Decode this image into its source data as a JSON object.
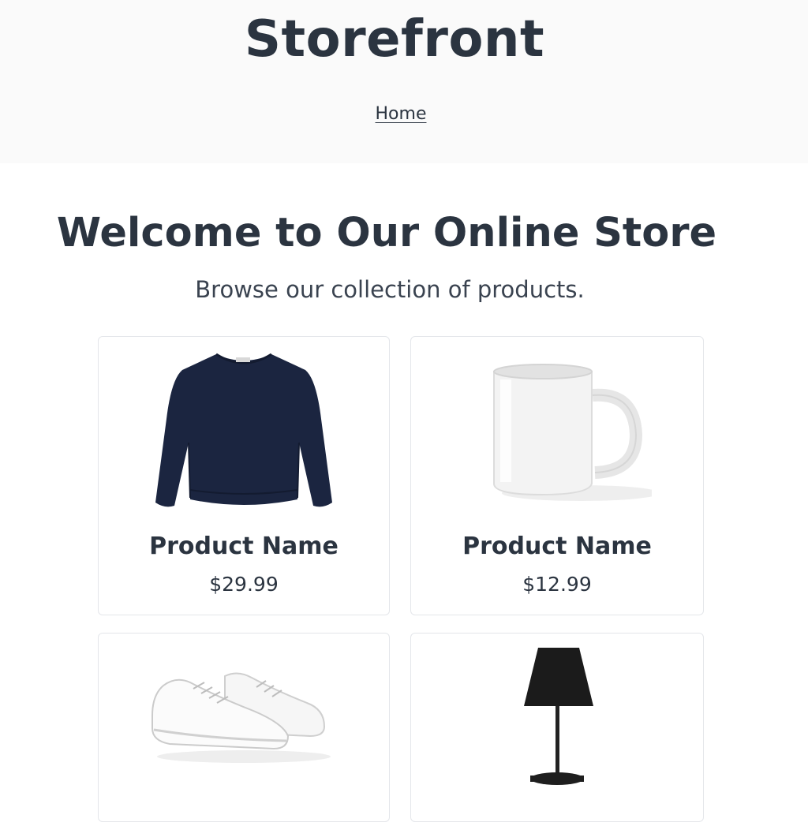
{
  "header": {
    "site_title": "Storefront",
    "nav": [
      {
        "label": "Home"
      }
    ]
  },
  "hero": {
    "title": "Welcome to Our Online Store",
    "subtitle": "Browse our collection of products."
  },
  "products": [
    {
      "image": "navy-sweater-image",
      "name": "Product Name",
      "price": "$29.99"
    },
    {
      "image": "white-mug-image",
      "name": "Product Name",
      "price": "$12.99"
    },
    {
      "image": "white-sneakers-image",
      "name": "",
      "price": ""
    },
    {
      "image": "black-lamp-image",
      "name": "",
      "price": ""
    }
  ],
  "colors": {
    "text": "#2b3440",
    "header_bg": "#fafafa",
    "card_border": "#e4e6ea",
    "sweater": "#1b2540"
  }
}
